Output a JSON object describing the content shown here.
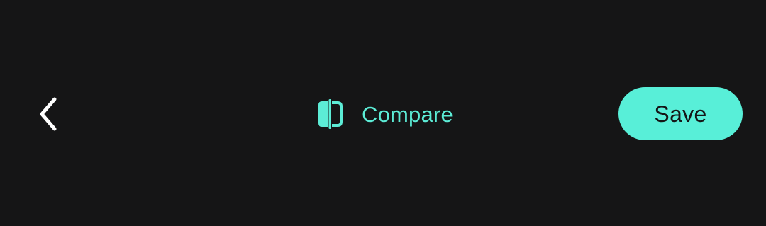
{
  "toolbar": {
    "back_icon": "chevron-left-icon",
    "compare_icon": "compare-split-icon",
    "compare_label": "Compare",
    "save_label": "Save"
  },
  "colors": {
    "background": "#151516",
    "accent": "#58efd8",
    "accent_text": "#5cecd6",
    "icon_light": "#ffffff",
    "save_text": "#151516"
  }
}
